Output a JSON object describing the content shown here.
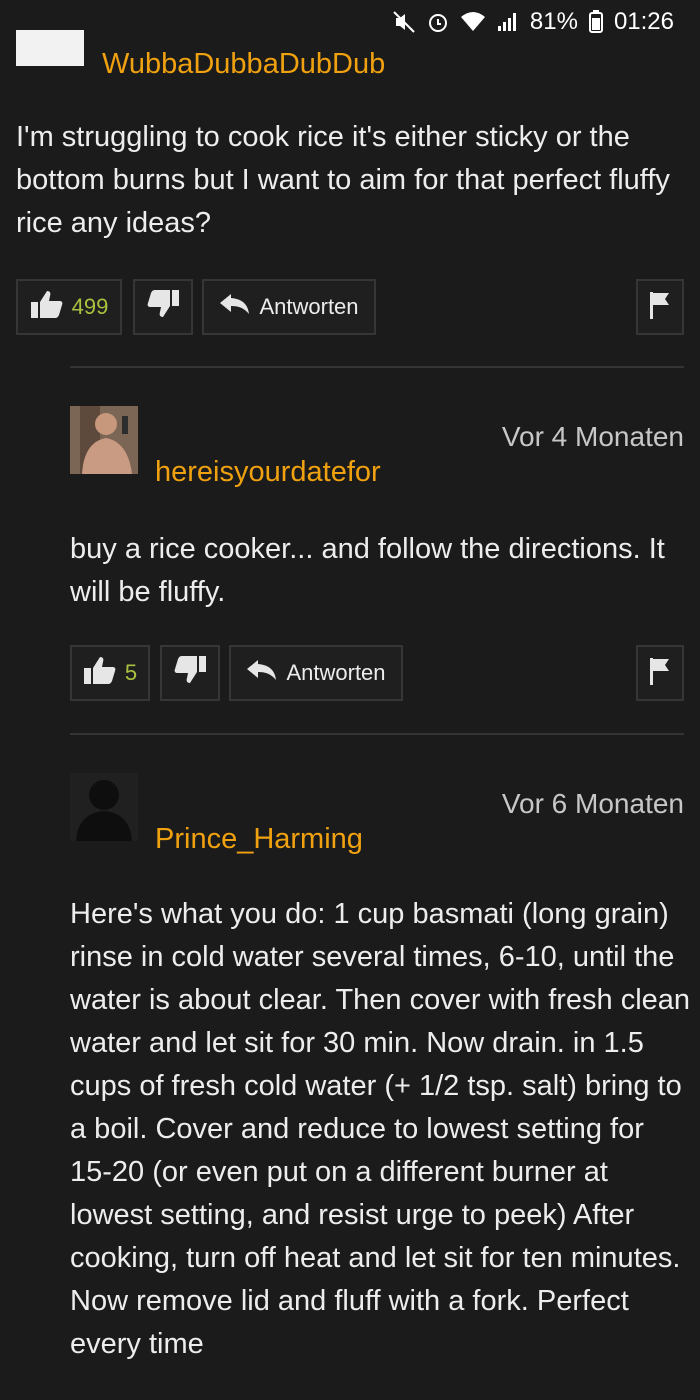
{
  "status_bar": {
    "battery": "81%",
    "time": "01:26",
    "icons": [
      "mute-icon",
      "alarm-icon",
      "wifi-icon",
      "signal-icon",
      "battery-icon"
    ]
  },
  "comments": [
    {
      "username": "WubbaDubbaDubDub",
      "text": "I'm struggling to cook rice it's either sticky or the bottom burns but I want to aim for that perfect fluffy rice any ideas?",
      "likes": "499",
      "reply_label": "Antworten"
    },
    {
      "username": "hereisyourdatefor",
      "time": "Vor 4 Monaten",
      "text": "buy a rice cooker... and follow the directions. It will be fluffy.",
      "likes": "5",
      "reply_label": "Antworten"
    },
    {
      "username": "Prince_Harming",
      "time": "Vor 6 Monaten",
      "text": "Here's what you do: 1 cup basmati (long grain) rinse in cold water several times, 6-10, until the water is about clear. Then cover with fresh clean water and let sit for 30 min. Now drain. in 1.5 cups of fresh cold water (+ 1/2 tsp. salt) bring to a boil. Cover and reduce to lowest setting for 15-20 (or even put on a different burner at lowest setting, and resist urge to peek) After cooking, turn off heat and let sit for ten minutes. Now remove lid and fluff with a fork. Perfect every time"
    }
  ],
  "colors": {
    "background": "#1b1b1b",
    "username": "#f0a10f",
    "like_count": "#a9c23f",
    "border": "#363636"
  }
}
